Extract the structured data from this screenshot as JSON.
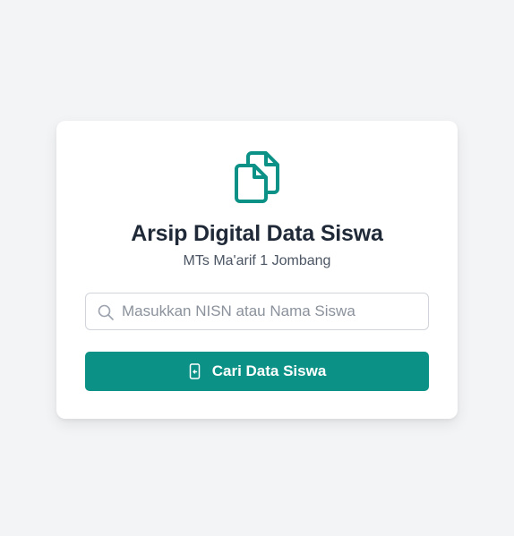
{
  "app": {
    "title": "Arsip Digital Data Siswa",
    "subtitle": "MTs Ma'arif 1 Jombang",
    "logo_icon": "documents-icon"
  },
  "search": {
    "placeholder": "Masukkan NISN atau Nama Siswa",
    "value": "",
    "icon": "search-icon"
  },
  "submit": {
    "label": "Cari Data Siswa",
    "icon": "phone-arrow-icon"
  },
  "colors": {
    "accent": "#0b9185",
    "background": "#f3f4f6",
    "title_text": "#1f2937",
    "subtitle_text": "#4b5563"
  }
}
